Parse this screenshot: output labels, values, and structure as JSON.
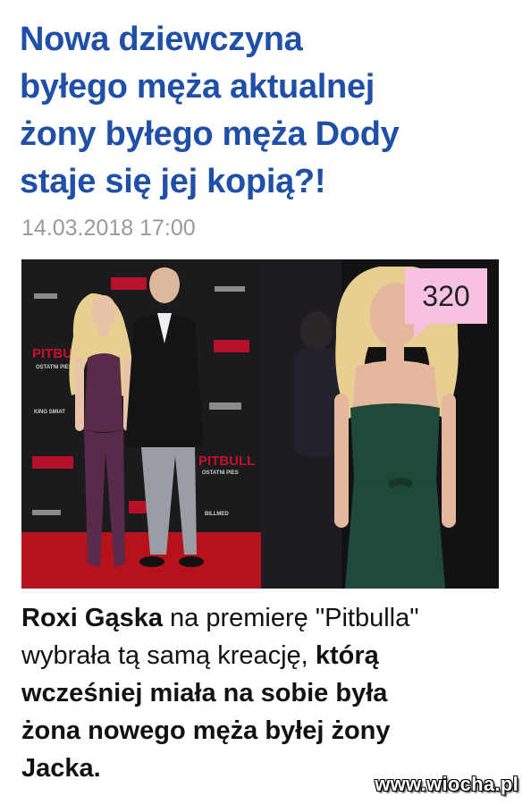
{
  "article": {
    "title_lines": [
      "Nowa dziewczyna",
      "byłego męża aktualnej",
      "żony byłego męża Dody",
      "staje się jej kopią?!"
    ],
    "date": "14.03.2018 17:00",
    "comment_count": "320",
    "photo": {
      "left_backdrop_texts": [
        "PITBULL",
        "OSTATNI PIES",
        "KING SMIAT",
        "BILLMED",
        "PITBULL",
        "OSTATNI PIES"
      ],
      "colors": {
        "red_carpet": "#b5121b",
        "backdrop": "#1a1a1a",
        "logo_red": "#c8102e",
        "dress_purple": "#5a2a4a",
        "dress_green": "#1f4a3a",
        "hair_blonde": "#e6cf91"
      }
    },
    "caption": {
      "line1_bold": "Roxi Gąska",
      "line1_rest": " na premierę \"Pitbulla\"",
      "line2_regular": "wybrała tą samą kreację, ",
      "line2_bold": "którą",
      "line3": "wcześniej miała na sobie była",
      "line4": "żona nowego męża byłej żony",
      "line5": "Jacka."
    }
  },
  "watermark": "www.wiocha.pl"
}
